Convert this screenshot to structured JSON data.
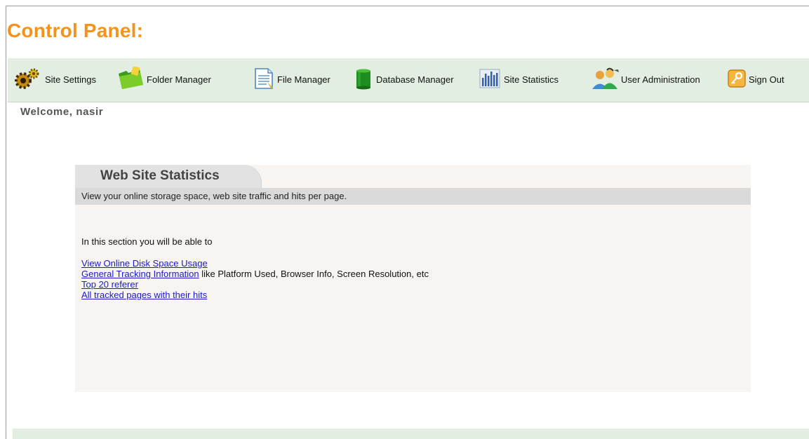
{
  "header": {
    "title": "Control Panel:"
  },
  "nav": {
    "items": [
      {
        "label": "Site Settings",
        "icon": "gears-icon"
      },
      {
        "label": "Folder Manager",
        "icon": "folder-icon"
      },
      {
        "label": "File Manager",
        "icon": "document-icon"
      },
      {
        "label": "Database Manager",
        "icon": "database-icon"
      },
      {
        "label": "Site Statistics",
        "icon": "bar-chart-icon"
      },
      {
        "label": "User Administration",
        "icon": "users-icon"
      },
      {
        "label": "Sign Out",
        "icon": "key-icon"
      }
    ]
  },
  "welcome": {
    "text": "Welcome, nasir"
  },
  "panel": {
    "title": "Web Site Statistics",
    "description": "View your online storage space, web site traffic and hits per page.",
    "intro": "In this section you will be able to",
    "links": [
      {
        "label": "View Online Disk Space Usage",
        "suffix": ""
      },
      {
        "label": "General Tracking Information",
        "suffix": " like Platform Used, Browser Info, Screen Resolution, etc"
      },
      {
        "label": "Top 20 referer",
        "suffix": ""
      },
      {
        "label": "All tracked pages with their hits",
        "suffix": ""
      }
    ]
  },
  "colors": {
    "title": "#f3931b",
    "nav_background": "#e3eee3",
    "panel_background": "#f7f4f1",
    "link": "#1a1acc"
  }
}
